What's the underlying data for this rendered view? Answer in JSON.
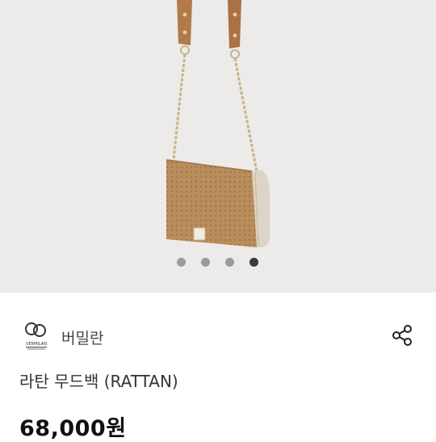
{
  "gallery": {
    "image_alt": "rattan mood bag",
    "slide_count": 4,
    "active_slide": 4
  },
  "brand": {
    "name": "버밀란",
    "logo_text": "VERMILAN",
    "icon": "brand-logo"
  },
  "product": {
    "title": "라탄 무드백 (RATTAN)",
    "price": "68,000원"
  },
  "actions": {
    "share_icon": "share-icon"
  },
  "colors": {
    "hero_bg": "#ecebe9",
    "dot_inactive": "#9b9b9b",
    "dot_active": "#3a3a3a"
  }
}
